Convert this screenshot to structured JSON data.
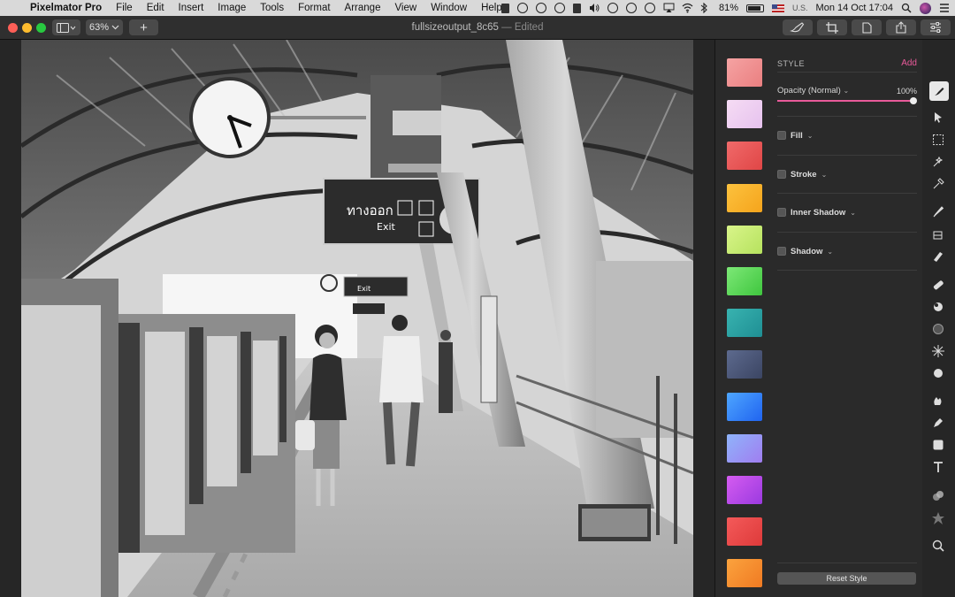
{
  "menubar": {
    "app_name": "Pixelmator Pro",
    "items": [
      "File",
      "Edit",
      "Insert",
      "Image",
      "Tools",
      "Format",
      "Arrange",
      "View",
      "Window",
      "Help"
    ],
    "battery": "81%",
    "input_source": "U.S.",
    "datetime": "Mon 14 Oct  17:04"
  },
  "toolbar": {
    "zoom": "63%",
    "add_label": "+",
    "document_name": "fullsizeoutput_8c65",
    "document_status": "— Edited"
  },
  "photo_signs": {
    "main_thai": "ทางออก",
    "main_english": "Exit",
    "small_english": "Exit"
  },
  "inspector": {
    "style_heading": "STYLE",
    "add_label": "Add",
    "opacity_label": "Opacity (Normal)",
    "opacity_caret": "⌄",
    "opacity_value": "100%",
    "opacity_fraction": 1.0,
    "accent_color": "#e85a9a",
    "effects": [
      {
        "label": "Fill",
        "caret": "⌄",
        "checked": false
      },
      {
        "label": "Stroke",
        "caret": "⌄",
        "checked": false
      },
      {
        "label": "Inner Shadow",
        "caret": "⌄",
        "checked": false
      },
      {
        "label": "Shadow",
        "caret": "⌄",
        "checked": false
      }
    ],
    "reset_label": "Reset Style",
    "swatches": [
      {
        "name": "salmon",
        "from": "#f5a3a3",
        "to": "#ea7f80"
      },
      {
        "name": "lavender",
        "from": "#f6dcf4",
        "to": "#e6c2ee"
      },
      {
        "name": "red",
        "from": "#f06a6a",
        "to": "#e04646"
      },
      {
        "name": "orange",
        "from": "#fcc23e",
        "to": "#f5a41c"
      },
      {
        "name": "lime",
        "from": "#d9f58a",
        "to": "#b6e25e"
      },
      {
        "name": "green",
        "from": "#7de877",
        "to": "#3fc63e"
      },
      {
        "name": "teal",
        "from": "#38b3b0",
        "to": "#1f8f94"
      },
      {
        "name": "navy",
        "from": "#5d6a8e",
        "to": "#3b4563"
      },
      {
        "name": "blue",
        "from": "#4ea6ff",
        "to": "#2064f0"
      },
      {
        "name": "periwinkle",
        "from": "#8fb4fb",
        "to": "#a07df0"
      },
      {
        "name": "purple",
        "from": "#d55cf0",
        "to": "#9b3ae0"
      },
      {
        "name": "crimson",
        "from": "#f45a5a",
        "to": "#de3a3a"
      },
      {
        "name": "amber",
        "from": "#fba33e",
        "to": "#f07a22"
      }
    ]
  },
  "tools": [
    "style-tool-icon",
    "arrange-tool-icon",
    "select-tool-icon",
    "quick-selection-icon",
    "color-selection-icon",
    "paint-brush-icon",
    "paint-bucket-icon",
    "eraser-icon",
    "retouch-icon",
    "clone-icon",
    "light-painting-icon",
    "sharpen-icon",
    "sponge-icon",
    "smudge-icon",
    "pen-icon",
    "shape-icon",
    "type-icon",
    "color-adjust-icon",
    "effects-icon",
    "zoom-icon"
  ]
}
